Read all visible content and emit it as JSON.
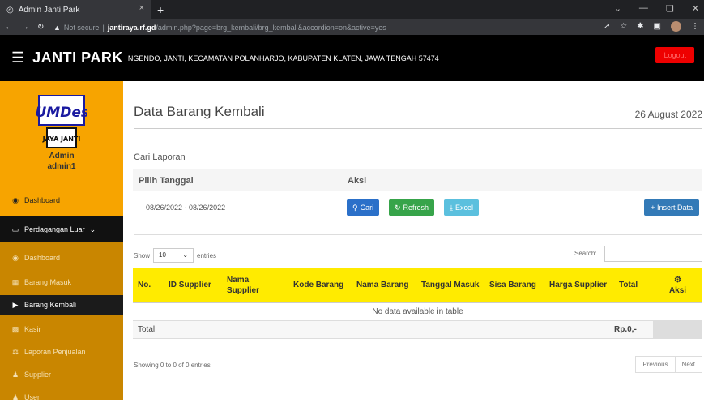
{
  "browser": {
    "tab_title": "Admin Janti Park",
    "close_glyph": "×",
    "newtab_glyph": "+",
    "not_secure": "Not secure",
    "url_host": "jantiraya.rf.gd",
    "url_path": "/admin.php?page=brg_kembali/brg_kembali&accordion=on&active=yes"
  },
  "header": {
    "brand": "JANTI PARK",
    "address": "NGENDO, JANTI, KECAMATAN POLANHARJO, KABUPATEN KLATEN, JAWA TENGAH 57474",
    "logout": "Logout"
  },
  "sidebar": {
    "logo_top": "BUMDesa",
    "logo_bottom": "JAYA JANTI",
    "role": "Admin",
    "username": "admin1",
    "dashboard": "Dashboard",
    "group": "Perdagangan Luar",
    "items": [
      {
        "label": "Dashboard"
      },
      {
        "label": "Barang Masuk"
      },
      {
        "label": "Barang Kembali"
      },
      {
        "label": "Kasir"
      },
      {
        "label": "Laporan Penjualan"
      },
      {
        "label": "Supplier"
      },
      {
        "label": "User"
      }
    ]
  },
  "page": {
    "title": "Data Barang Kembali",
    "date": "26 August 2022",
    "section": "Cari Laporan",
    "col_date": "Pilih Tanggal",
    "col_action": "Aksi",
    "date_range": "08/26/2022 - 08/26/2022",
    "btn_cari": "Cari",
    "btn_refresh": "Refresh",
    "btn_excel": "Excel",
    "btn_insert": "+ Insert Data",
    "show": "Show",
    "entries_value": "10",
    "entries": "entries",
    "search": "Search:",
    "no_data": "No data available in table",
    "total_label": "Total",
    "total_value": "Rp.0,-",
    "showing": "Showing 0 to 0 of 0 entries",
    "previous": "Previous",
    "next": "Next"
  },
  "table": {
    "headers": [
      "No.",
      "ID Supplier",
      "Nama Supplier",
      "Kode Barang",
      "Nama Barang",
      "Tanggal Masuk",
      "Sisa Barang",
      "Harga Supplier",
      "Total",
      "Aksi"
    ]
  },
  "colors": {
    "sidebar": "#f7a400",
    "header_bg": "#000000",
    "table_header": "#ffeb00",
    "logout": "#ee0000",
    "insert": "#337ab7"
  }
}
